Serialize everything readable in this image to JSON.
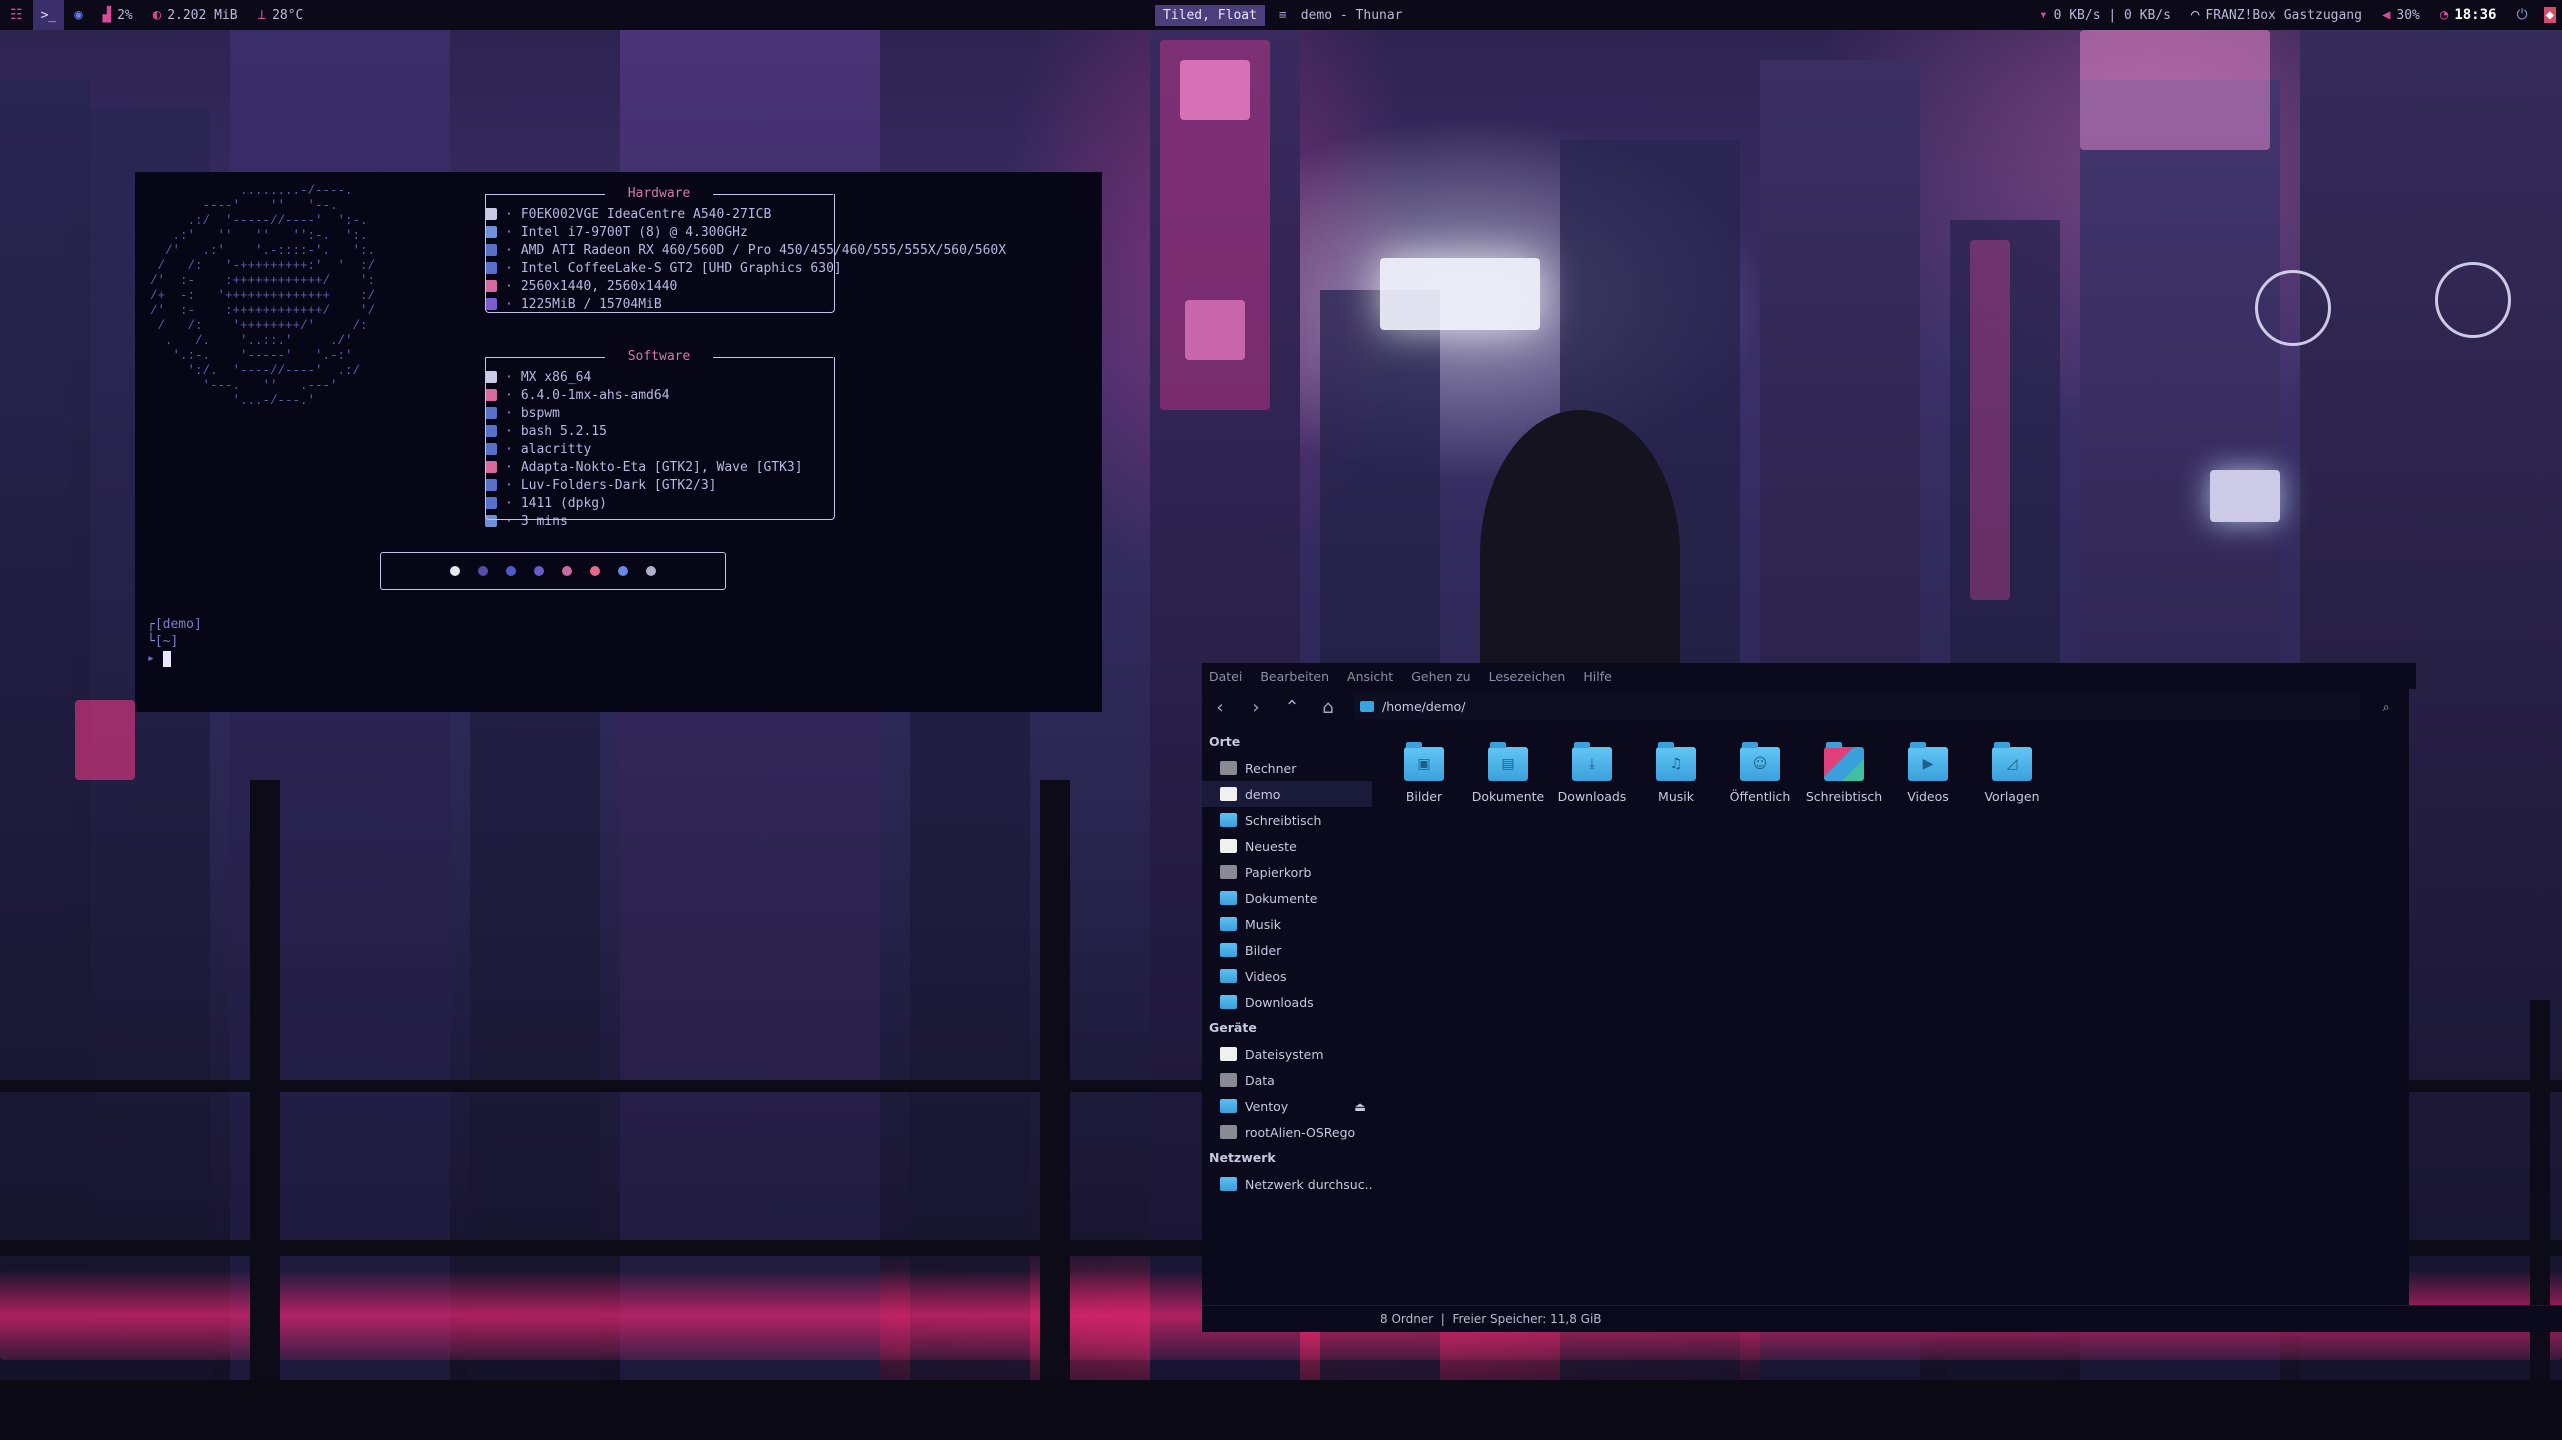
{
  "topbar": {
    "cpu": "2%",
    "memory": "2.202 MiB",
    "temperature": "28°C",
    "layout_mode": "Tiled, Float",
    "window_title": "demo - Thunar",
    "network": "0 KB/s | 0 KB/s",
    "wifi": "FRANZ!Box Gastzugang",
    "volume": "30%",
    "time": "18:36"
  },
  "terminal": {
    "hardware_title": "Hardware",
    "hardware": [
      {
        "text": "F0EK002VGE IdeaCentre A540-27ICB",
        "color": "#c9c9e8"
      },
      {
        "text": "Intel i7-9700T (8) @ 4.300GHz",
        "color": "#6f8fd8"
      },
      {
        "text": "AMD ATI Radeon RX 460/560D / Pro 450/455/460/555/555X/560/560X",
        "color": "#5870c8"
      },
      {
        "text": "Intel CoffeeLake-S GT2 [UHD Graphics 630]",
        "color": "#5870c8"
      },
      {
        "text": "2560x1440, 2560x1440",
        "color": "#d56aa0"
      },
      {
        "text": "1225MiB / 15704MiB",
        "color": "#7a5bd0"
      }
    ],
    "software_title": "Software",
    "software": [
      {
        "text": "MX x86_64",
        "color": "#c9c9e8"
      },
      {
        "text": "6.4.0-1mx-ahs-amd64",
        "color": "#d56aa0"
      },
      {
        "text": "bspwm",
        "color": "#5870c8"
      },
      {
        "text": "bash 5.2.15",
        "color": "#5870c8"
      },
      {
        "text": "alacritty",
        "color": "#5870c8"
      },
      {
        "text": "Adapta-Nokto-Eta [GTK2], Wave [GTK3]",
        "color": "#d56aa0"
      },
      {
        "text": "Luv-Folders-Dark [GTK2/3]",
        "color": "#5870c8"
      },
      {
        "text": "1411 (dpkg)",
        "color": "#5870c8"
      },
      {
        "text": "3 mins",
        "color": "#6f8fd8"
      }
    ],
    "palette": [
      "#e8e8f0",
      "#5a4aa8",
      "#4a5bc8",
      "#6a5ac8",
      "#c86aa0",
      "#e86a8a",
      "#6a8ae8",
      "#b0b0c8"
    ],
    "prompt_dir": "[demo]",
    "prompt_sub": "[~]"
  },
  "thunar": {
    "menu": [
      "Datei",
      "Bearbeiten",
      "Ansicht",
      "Gehen zu",
      "Lesezeichen",
      "Hilfe"
    ],
    "path": "/home/demo/",
    "sidebar": {
      "places_title": "Orte",
      "places": [
        {
          "label": "Rechner",
          "icon": "computer-icon"
        },
        {
          "label": "demo",
          "icon": "home-icon"
        },
        {
          "label": "Schreibtisch",
          "icon": "desktop-icon"
        },
        {
          "label": "Neueste",
          "icon": "recent-icon"
        },
        {
          "label": "Papierkorb",
          "icon": "trash-icon"
        },
        {
          "label": "Dokumente",
          "icon": "folder-icon"
        },
        {
          "label": "Musik",
          "icon": "folder-icon"
        },
        {
          "label": "Bilder",
          "icon": "folder-icon"
        },
        {
          "label": "Videos",
          "icon": "folder-icon"
        },
        {
          "label": "Downloads",
          "icon": "folder-icon"
        }
      ],
      "devices_title": "Geräte",
      "devices": [
        {
          "label": "Dateisystem",
          "icon": "filesystem-icon"
        },
        {
          "label": "Data",
          "icon": "drive-icon"
        },
        {
          "label": "Ventoy",
          "icon": "usb-drive-icon"
        },
        {
          "label": "rootAlien-OSRego",
          "icon": "drive-icon"
        }
      ],
      "network_title": "Netzwerk",
      "network": [
        {
          "label": "Netzwerk durchsuc...",
          "icon": "network-icon"
        }
      ]
    },
    "files": [
      {
        "label": "Bilder",
        "glyph": "▣"
      },
      {
        "label": "Dokumente",
        "glyph": "▤"
      },
      {
        "label": "Downloads",
        "glyph": "⤓"
      },
      {
        "label": "Musik",
        "glyph": "♫"
      },
      {
        "label": "Öffentlich",
        "glyph": "☺"
      },
      {
        "label": "Schreibtisch",
        "glyph": ""
      },
      {
        "label": "Videos",
        "glyph": "▶"
      },
      {
        "label": "Vorlagen",
        "glyph": "◿"
      }
    ],
    "status": "8 Ordner  |  Freier Speicher: 11,8 GiB"
  }
}
